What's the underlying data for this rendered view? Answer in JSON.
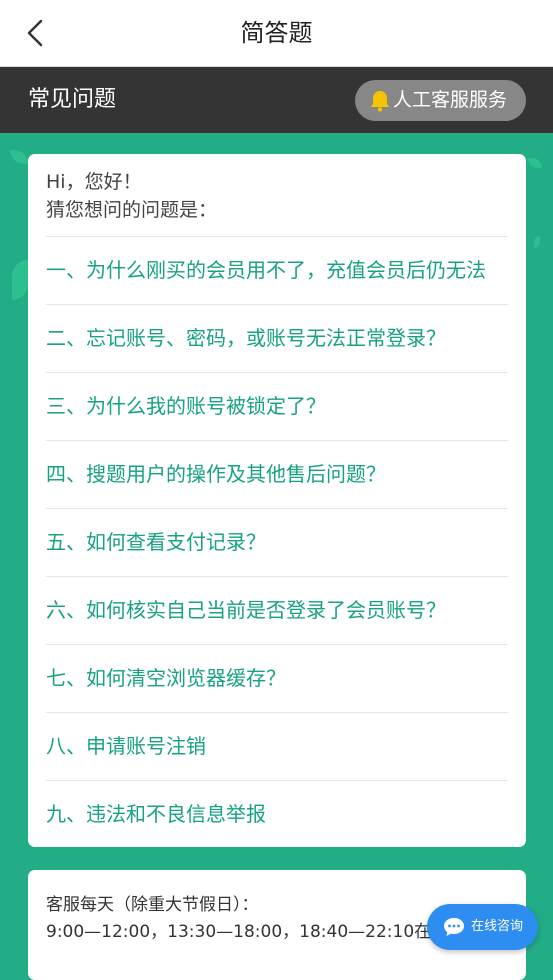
{
  "header": {
    "title": "简答题"
  },
  "bar": {
    "title": "常见问题",
    "service_button": "人工客服服务"
  },
  "card": {
    "greeting_line1": "Hi，您好！",
    "greeting_line2": "猜您想问的问题是：",
    "questions": [
      "一、为什么刚买的会员用不了，充值会员后仍无法",
      "二、忘记账号、密码，或账号无法正常登录？",
      "三、为什么我的账号被锁定了？",
      "四、搜题用户的操作及其他售后问题？",
      "五、如何查看支付记录？",
      "六、如何核实自己当前是否登录了会员账号？",
      "七、如何清空浏览器缓存？",
      "八、申请账号注销",
      "九、违法和不良信息举报"
    ]
  },
  "service_hours": {
    "line1": "客服每天（除重大节假日）：",
    "line2": "9:00—12:00，13:30—18:00，18:40—22:10在线"
  },
  "consult_button": "在线咨询",
  "colors": {
    "accent": "#17a283",
    "background": "#22ad87",
    "bar": "#343434",
    "consult": "#2e8df0"
  },
  "icons": {
    "back": "chevron-left-icon",
    "service": "bell-icon",
    "consult": "chat-bubble-icon"
  }
}
